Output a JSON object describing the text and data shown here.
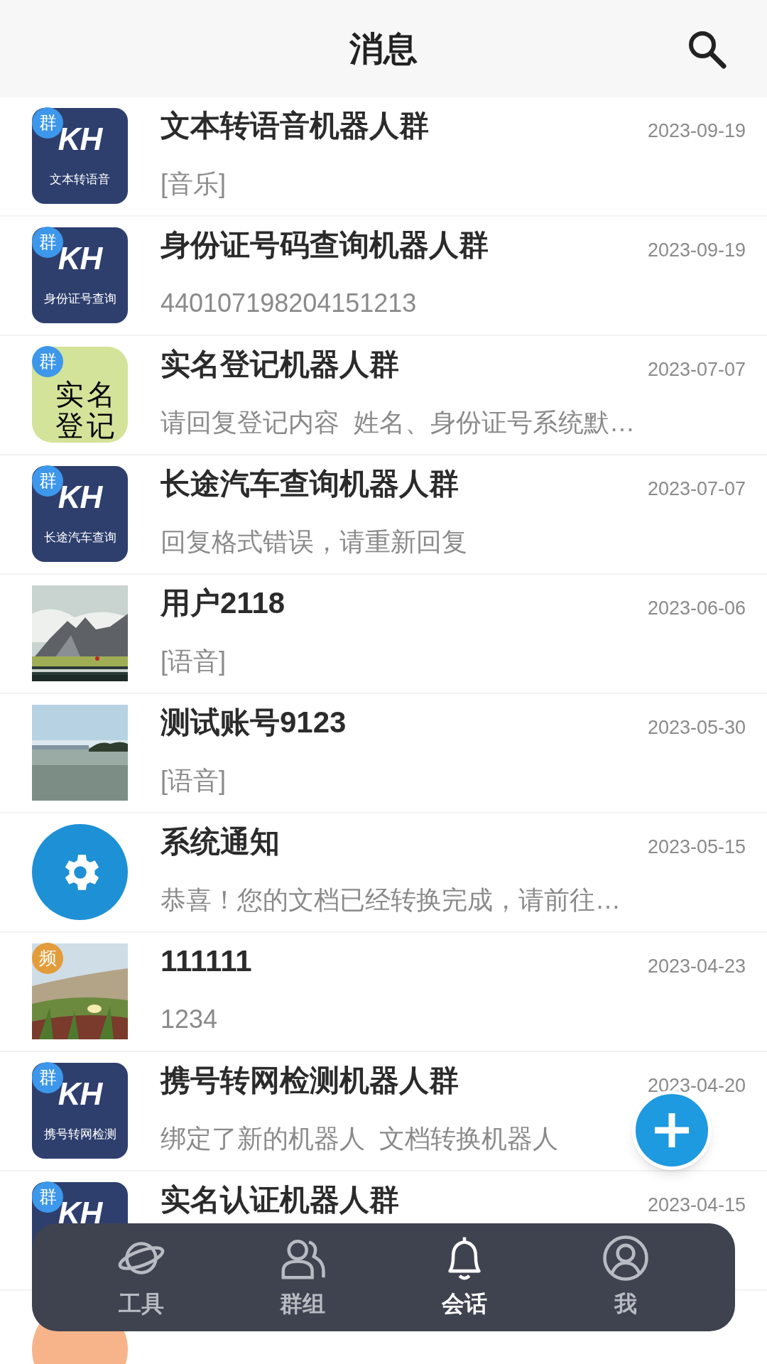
{
  "header": {
    "title": "消息"
  },
  "conversations": [
    {
      "avatar": {
        "kind": "kh",
        "logo": "KH",
        "caption": "文本转语音"
      },
      "badge": {
        "label": "群",
        "kind": "group"
      },
      "title": "文本转语音机器人群",
      "date": "2023-09-19",
      "preview": "[音乐]"
    },
    {
      "avatar": {
        "kind": "kh",
        "logo": "KH",
        "caption": "身份证号查询"
      },
      "badge": {
        "label": "群",
        "kind": "group"
      },
      "title": "身份证号码查询机器人群",
      "date": "2023-09-19",
      "preview": "440107198204151213"
    },
    {
      "avatar": {
        "kind": "tile",
        "lines": [
          "实名",
          "登记"
        ]
      },
      "badge": {
        "label": "群",
        "kind": "group"
      },
      "title": "实名登记机器人群",
      "date": "2023-07-07",
      "preview": "请回复登记内容  姓名、身份证号系统默…"
    },
    {
      "avatar": {
        "kind": "kh",
        "logo": "KH",
        "caption": "长途汽车查询"
      },
      "badge": {
        "label": "群",
        "kind": "group"
      },
      "title": "长途汽车查询机器人群",
      "date": "2023-07-07",
      "preview": "回复格式错误，请重新回复"
    },
    {
      "title": "用户2118",
      "date": "2023-06-06",
      "preview": "[语音]"
    },
    {
      "title": "测试账号9123",
      "date": "2023-05-30",
      "preview": "[语音]"
    },
    {
      "avatar": {
        "kind": "system"
      },
      "title": "系统通知",
      "date": "2023-05-15",
      "preview": "恭喜！您的文档已经转换完成，请前往…"
    },
    {
      "badge": {
        "label": "频",
        "kind": "channel"
      },
      "title": "111111",
      "date": "2023-04-23",
      "preview": "1234"
    },
    {
      "avatar": {
        "kind": "kh",
        "logo": "KH",
        "caption": "携号转网检测"
      },
      "badge": {
        "label": "群",
        "kind": "group"
      },
      "title": "携号转网检测机器人群",
      "date": "2023-04-20",
      "preview": "绑定了新的机器人  文档转换机器人"
    },
    {
      "avatar": {
        "kind": "kh",
        "logo": "KH"
      },
      "badge": {
        "label": "群",
        "kind": "group"
      },
      "title": "实名认证机器人群",
      "date": "2023-04-15"
    },
    {
      "avatar": {
        "kind": "letter"
      }
    }
  ],
  "tab_bar": [
    {
      "label": "工具",
      "selected": false
    },
    {
      "label": "群组",
      "selected": false
    },
    {
      "label": "会话",
      "selected": true
    },
    {
      "label": "我",
      "selected": false
    }
  ]
}
